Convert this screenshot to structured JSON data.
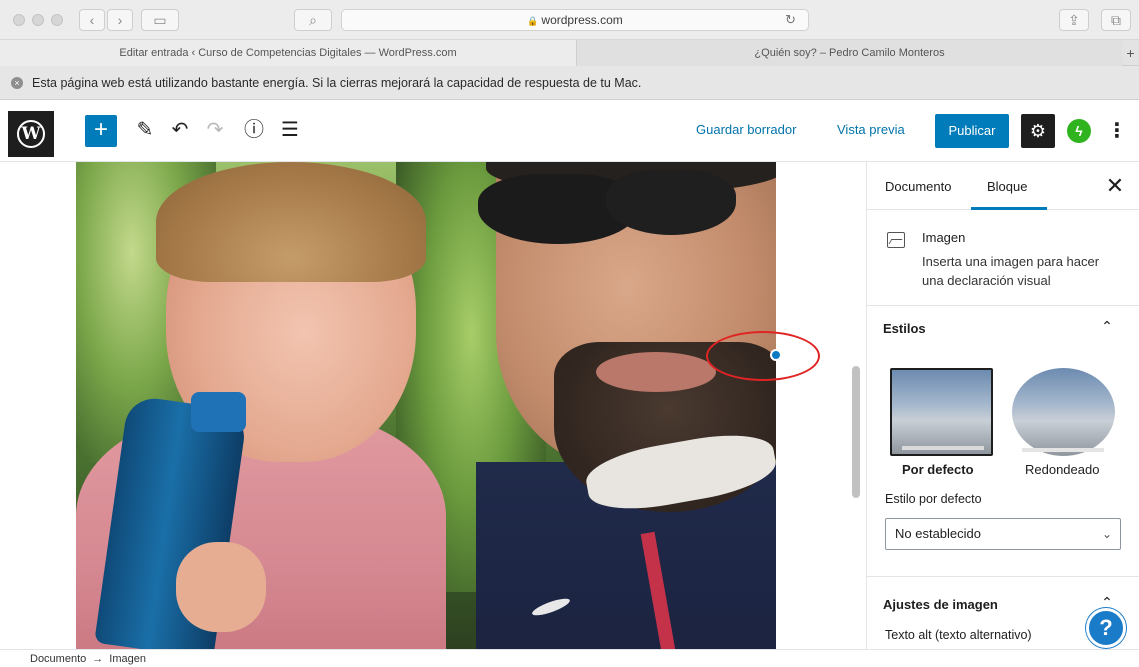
{
  "browser": {
    "url": "wordpress.com",
    "tabs": [
      {
        "label": "Editar entrada ‹ Curso de Competencias Digitales — WordPress.com"
      },
      {
        "label": "¿Quién soy? – Pedro Camilo Monteros"
      }
    ],
    "warning": "Esta página web está utilizando bastante energía. Si la cierras mejorará la capacidad de respuesta de tu Mac."
  },
  "toolbar": {
    "save_draft": "Guardar borrador",
    "preview": "Vista previa",
    "publish": "Publicar"
  },
  "sidebar": {
    "tabs": [
      "Documento",
      "Bloque"
    ],
    "block": {
      "title": "Imagen",
      "description": "Inserta una imagen para hacer una declaración visual"
    },
    "styles": {
      "title": "Estilos",
      "options": [
        "Por defecto",
        "Redondeado"
      ],
      "default_label": "Estilo por defecto",
      "default_value": "No establecido"
    },
    "image_settings": {
      "title": "Ajustes de imagen",
      "alt_label": "Texto alt (texto alternativo)"
    }
  },
  "footer": {
    "breadcrumb": [
      "Documento",
      "Imagen"
    ]
  },
  "colors": {
    "accent": "#007cba",
    "annotation": "#e02424"
  }
}
